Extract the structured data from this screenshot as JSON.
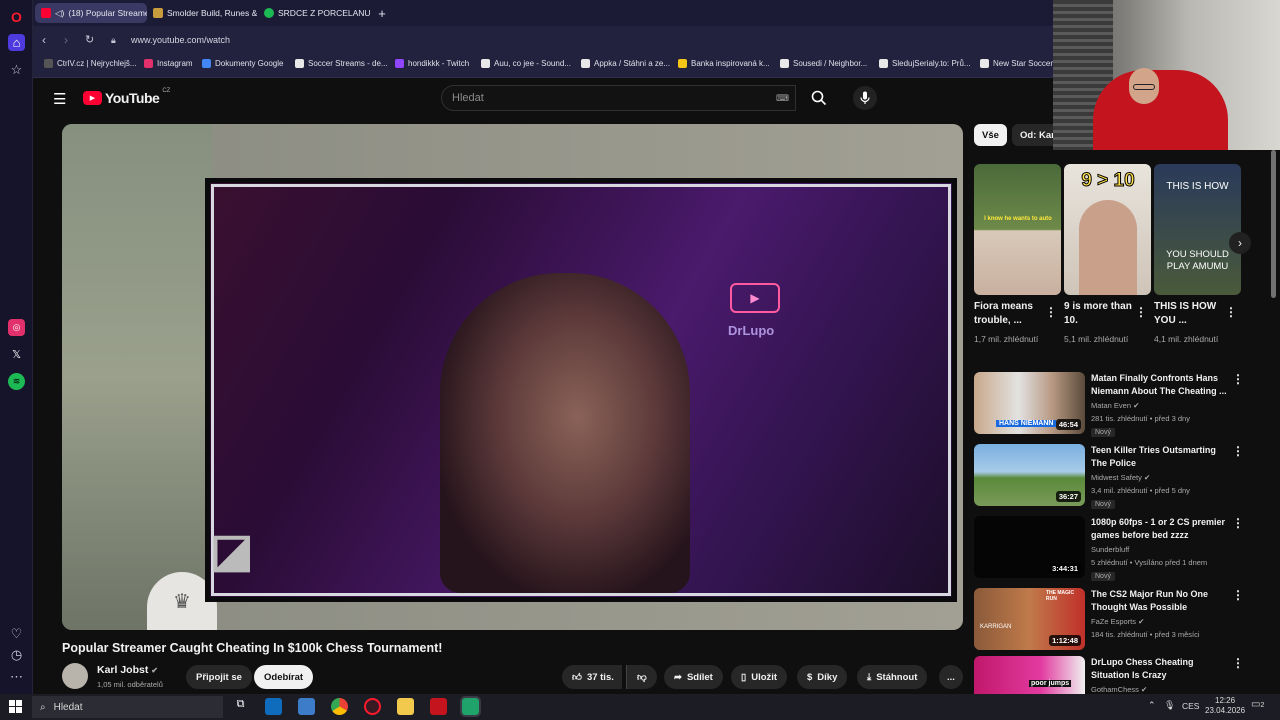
{
  "browser": {
    "tabs": [
      {
        "label": "(18) Popular Streamer",
        "color": "#ff0033"
      },
      {
        "label": "Smolder Build, Runes & C",
        "color": "#c89b3c"
      },
      {
        "label": "SRDCE Z PORCELANU - A",
        "color": "#1db954"
      }
    ],
    "new_tab": "+",
    "url": "www.youtube.com/watch",
    "bookmarks": [
      {
        "label": "CtrlV.cz | Nejrychlejš...",
        "color": "#555555"
      },
      {
        "label": "Instagram",
        "color": "#e1306c"
      },
      {
        "label": "Dokumenty Google",
        "color": "#4285f4"
      },
      {
        "label": "Soccer Streams - de...",
        "color": "#e8e8e8"
      },
      {
        "label": "hondikkk - Twitch",
        "color": "#9146ff"
      },
      {
        "label": "Auu, co jee - Sound...",
        "color": "#e8e8e8"
      },
      {
        "label": "Appka / Stáhni a ze...",
        "color": "#e8e8e8"
      },
      {
        "label": "Banka inspirovaná k...",
        "color": "#f5c518"
      },
      {
        "label": "Sousedi / Neighbor...",
        "color": "#e8e8e8"
      },
      {
        "label": "SledujSerialy.to: Prů...",
        "color": "#e8e8e8"
      },
      {
        "label": "New Star Soccer",
        "color": "#e8e8e8"
      }
    ]
  },
  "youtube": {
    "logo_text": "YouTube",
    "logo_region": "CZ",
    "search_placeholder": "Hledat",
    "video_title": "Popular Streamer Caught Cheating In $100k Chess Tournament!",
    "channel": {
      "name": "Karl Jobst",
      "subscribers": "1,05 mil. odběratelů"
    },
    "join_label": "Připojit se",
    "subscribe_label": "Odebírat",
    "likes": "37 tis.",
    "share_label": "Sdílet",
    "save_label": "Uložit",
    "thanks_label": "Díky",
    "download_label": "Stáhnout",
    "more_label": "...",
    "overlay_text": "DrLupo",
    "chips": [
      "Vše",
      "Od: Karl"
    ],
    "shorts": [
      {
        "title": "Fiora means trouble, ...",
        "views": "1,7 mil. zhlédnutí",
        "thumb_text": "I know he wants to auto"
      },
      {
        "title": "9 is more than 10.",
        "views": "5,1 mil. zhlédnutí",
        "thumb_text": "9 > 10"
      },
      {
        "title": "THIS IS HOW YOU ...",
        "views": "4,1 mil. zhlédnutí",
        "thumb_text": "THIS IS HOW",
        "thumb_text2": "YOU SHOULD PLAY AMUMU"
      }
    ],
    "recommendations": [
      {
        "title": "Matan Finally Confronts Hans Niemann About The Cheating ...",
        "channel": "Matan Even",
        "meta": "281 tis. zhlédnutí • před 3 dny",
        "duration": "46:54",
        "badge": "Nový",
        "thumb_text": "HANS NIEMANN"
      },
      {
        "title": "Teen Killer Tries Outsmarting The Police",
        "channel": "Midwest Safety",
        "meta": "3,4 mil. zhlédnutí • před 5 dny",
        "duration": "36:27",
        "badge": "Nový"
      },
      {
        "title": "1080p 60fps - 1 or 2 CS premier games before bed zzzz",
        "channel": "Sunderbluff",
        "meta": "5 zhlédnutí • Vysíláno před 1 dnem",
        "duration": "3:44:31",
        "badge": "Nový"
      },
      {
        "title": "The CS2 Major Run No One Thought Was Possible",
        "channel": "FaZe Esports",
        "meta": "184 tis. zhlédnutí • před 3 měsíci",
        "duration": "1:12:48",
        "thumb_text": "THE MAGIC RUN",
        "thumb_text2": "KARRIGAN"
      },
      {
        "title": "DrLupo Chess Cheating Situation Is Crazy",
        "channel": "GothamChess",
        "thumb_text": "poor jumps"
      }
    ]
  },
  "taskbar": {
    "search_placeholder": "Hledat",
    "language": "CES",
    "time": "12:26",
    "date": "23.04.2026",
    "notifications": "2"
  }
}
